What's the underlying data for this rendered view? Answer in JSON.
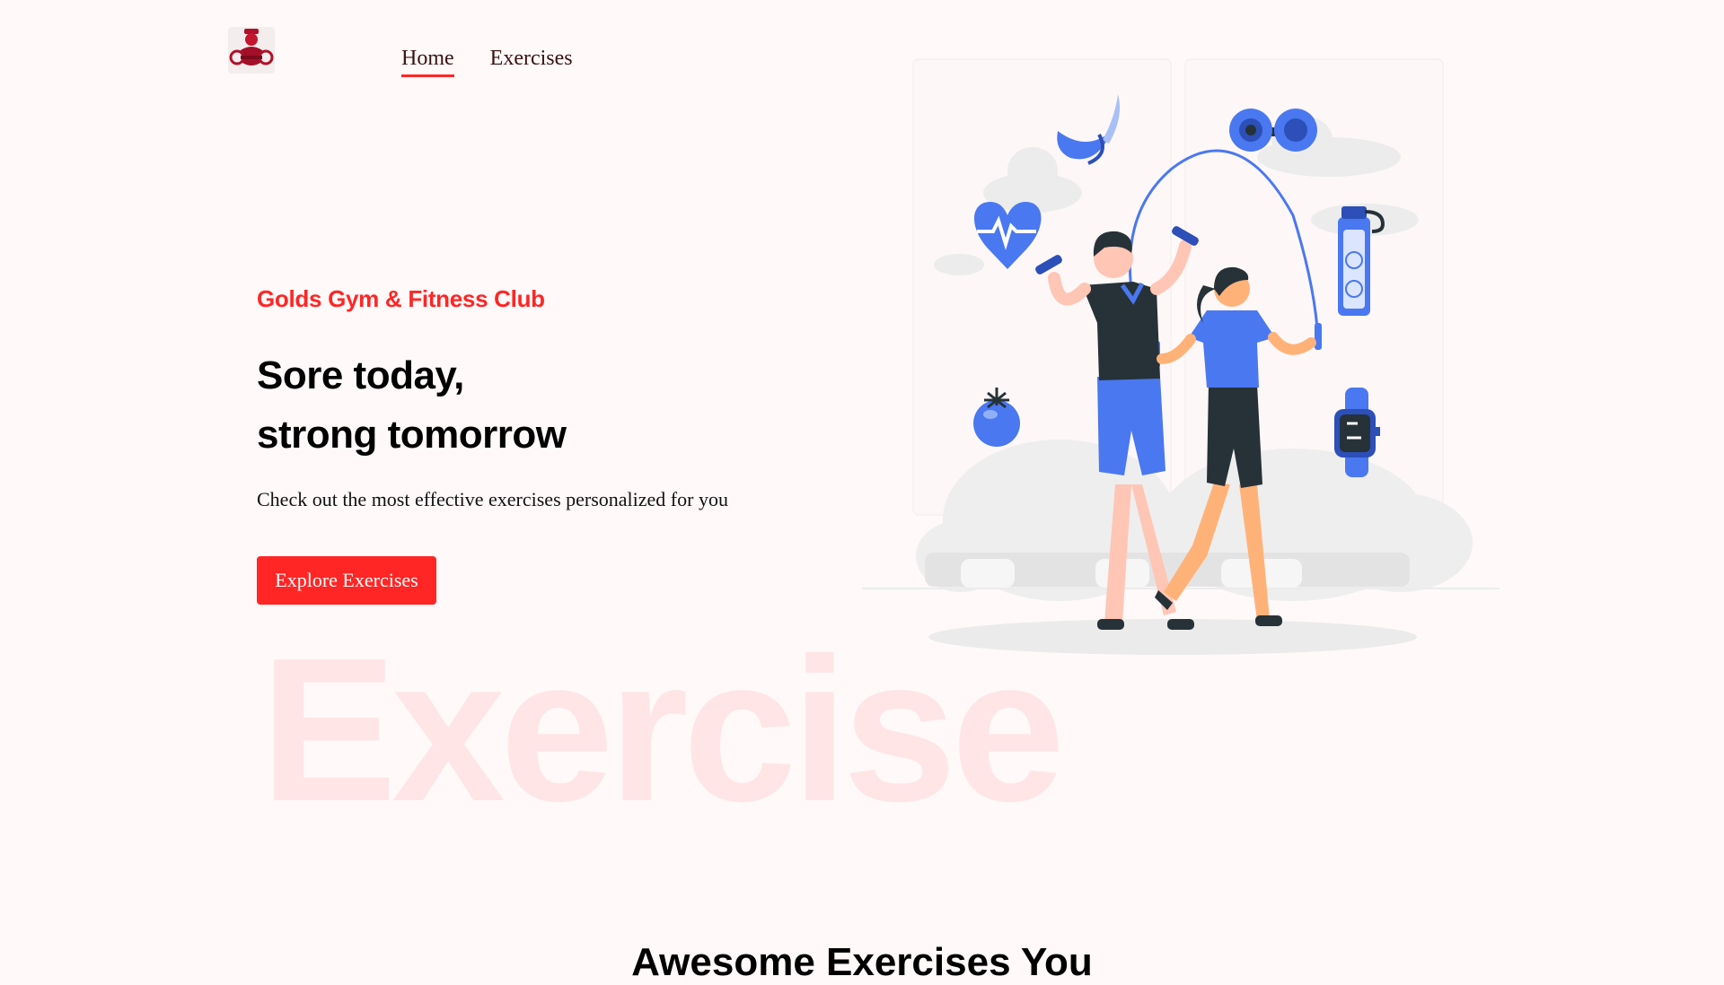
{
  "nav": {
    "items": [
      {
        "label": "Home",
        "active": true
      },
      {
        "label": "Exercises",
        "active": false
      }
    ]
  },
  "hero": {
    "club_name": "Golds Gym & Fitness Club",
    "headline_line1": "Sore today,",
    "headline_line2": "strong tomorrow",
    "subtext": "Check out the most effective exercises personalized for you",
    "cta_label": "Explore Exercises",
    "watermark": "Exercise"
  },
  "next_section": {
    "title": "Awesome Exercises You"
  },
  "colors": {
    "accent": "#ff2625",
    "background": "#fff9f9",
    "illustration_blue": "#4a78f0"
  },
  "icons": [
    "logo-icon",
    "banana-icon",
    "dumbbell-icon",
    "heart-rate-icon",
    "water-bottle-icon",
    "tomato-icon",
    "smartwatch-icon"
  ]
}
